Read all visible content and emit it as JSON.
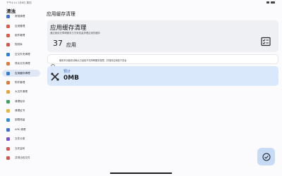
{
  "statusbar": {
    "time": "下午4:14 1月8日 周四"
  },
  "app": {
    "title": "清浊"
  },
  "sidebar": {
    "items": [
      {
        "label": "常规清理",
        "icon": "broom-icon",
        "color": "#3d6fd8"
      },
      {
        "label": "应用管理",
        "icon": "apps-icon",
        "color": "#e05a4e"
      },
      {
        "label": "组件管理",
        "icon": "component-icon",
        "color": "#e05a4e"
      },
      {
        "label": "规则库",
        "icon": "flag-icon",
        "color": "#d9534f"
      },
      {
        "label": "空文件夹清理",
        "icon": "folder-icon",
        "color": "#2f7fd6"
      },
      {
        "label": "残余文件清理",
        "icon": "residual-file-icon",
        "color": "#e0793a"
      },
      {
        "label": "应用缓存清理",
        "icon": "cache-icon",
        "color": "#2f7fd6"
      },
      {
        "label": "附件管理",
        "icon": "attachment-icon",
        "color": "#e0793a"
      },
      {
        "label": "大文件清理",
        "icon": "big-file-icon",
        "color": "#e8a13a"
      },
      {
        "label": "清理轮存",
        "icon": "storage-icon",
        "color": "#3aa55a"
      },
      {
        "label": "清理证书",
        "icon": "certificate-icon",
        "color": "#e8b73a"
      },
      {
        "label": "卸载残留",
        "icon": "uninstall-icon",
        "color": "#2f8fd6"
      },
      {
        "label": "APK 清理",
        "icon": "apk-icon",
        "color": "#3d6fd8"
      },
      {
        "label": "文件分类",
        "icon": "file-category-icon",
        "color": "#7a4fd0"
      },
      {
        "label": "文件监听",
        "icon": "monitor-icon",
        "color": "#d9534f"
      },
      {
        "label": "并排比较文件",
        "icon": "compare-icon",
        "color": "#d9534f"
      }
    ]
  },
  "page": {
    "title": "应用缓存清理"
  },
  "summary": {
    "title": "应用缓存清理",
    "description": "通过使用无障碍服务方式来批量清理应用的缓存",
    "count": "37",
    "unit": "应用",
    "action_icon": "checklist-icon"
  },
  "info": {
    "icon": "info-icon",
    "text": "使用本功能前请确认已经给予无障碍服务权限，并保持应用处于前台"
  },
  "estimate": {
    "icon": "tools-icon",
    "label": "预计",
    "value": "0MB"
  },
  "fab": {
    "icon": "check-circle-icon"
  },
  "colors": {
    "accent": "#3864c8",
    "active_bg": "#dfe7f7",
    "estimate_bg": "#d9e9fb",
    "fab_bg": "#c7dbf7"
  }
}
